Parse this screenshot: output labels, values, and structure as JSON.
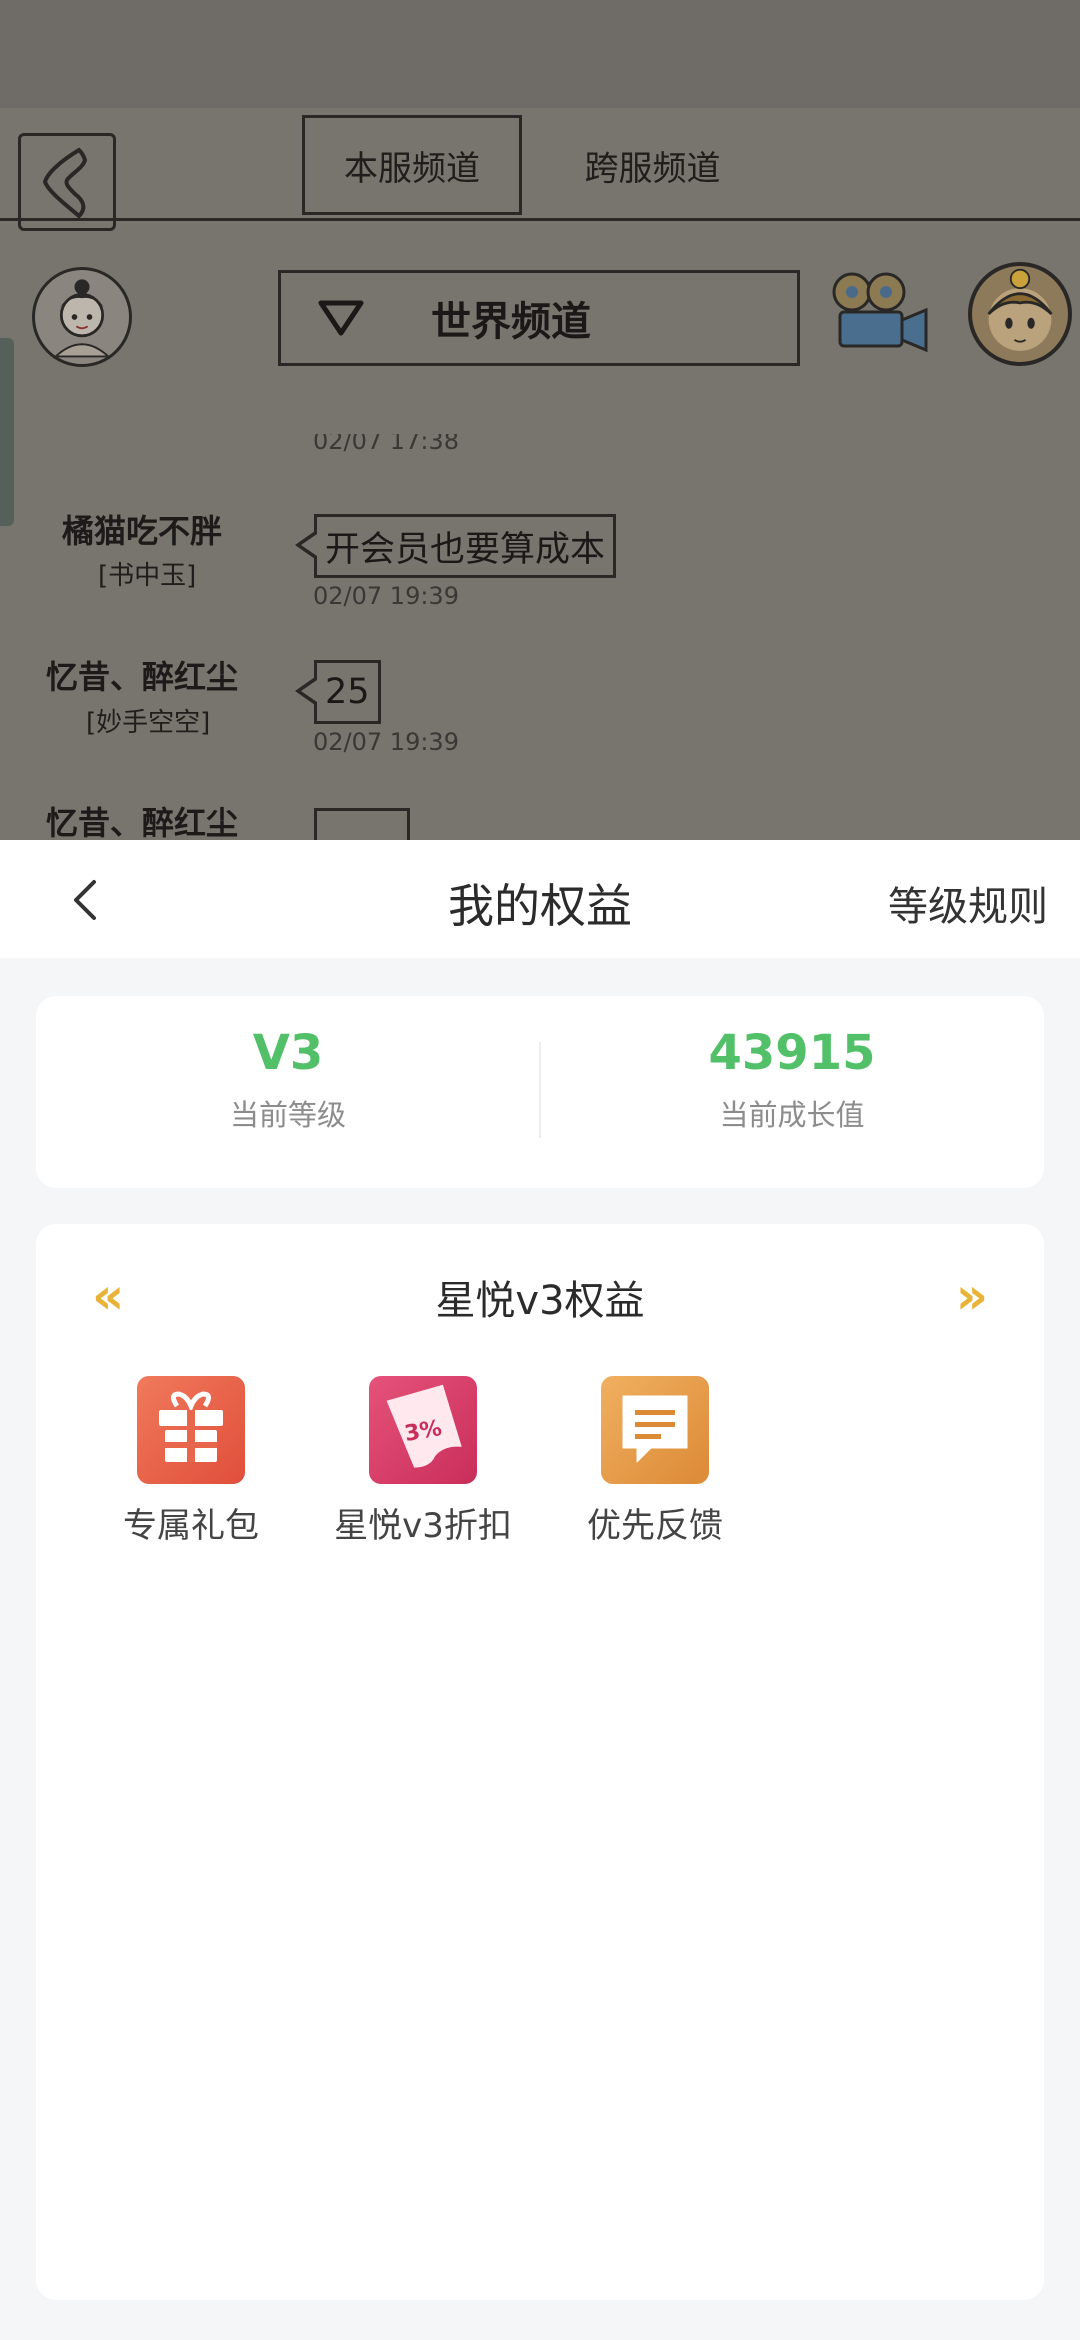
{
  "game": {
    "tabs": [
      "本服频道",
      "跨服频道"
    ],
    "channel_label": "世界频道",
    "messages": [
      {
        "name": "橘猫吃不胖",
        "tag": "[书中玉]",
        "text": "开会员也要算成本",
        "time": "02/07 19:39"
      },
      {
        "name": "忆昔、醉红尘",
        "tag": "[妙手空空]",
        "text": "25",
        "time": "02/07 19:39"
      },
      {
        "name": "忆昔、醉红尘"
      }
    ],
    "partial_time": "02/07 17:38"
  },
  "sheet": {
    "title": "我的权益",
    "rules_label": "等级规则",
    "stats": [
      {
        "value": "V3",
        "label": "当前等级"
      },
      {
        "value": "43915",
        "label": "当前成长值"
      }
    ],
    "benefits_title": "星悦v3权益",
    "prev_arrow": "«",
    "next_arrow": "»",
    "benefits": [
      {
        "label": "专属礼包",
        "icon": "gift-icon",
        "color": "#e8664c"
      },
      {
        "label": "星悦v3折扣",
        "icon": "discount-icon",
        "color": "#d9406b"
      },
      {
        "label": "优先反馈",
        "icon": "feedback-icon",
        "color": "#e59a45"
      }
    ],
    "accent_color": "#52c068",
    "arrow_color": "#e9b33a"
  }
}
